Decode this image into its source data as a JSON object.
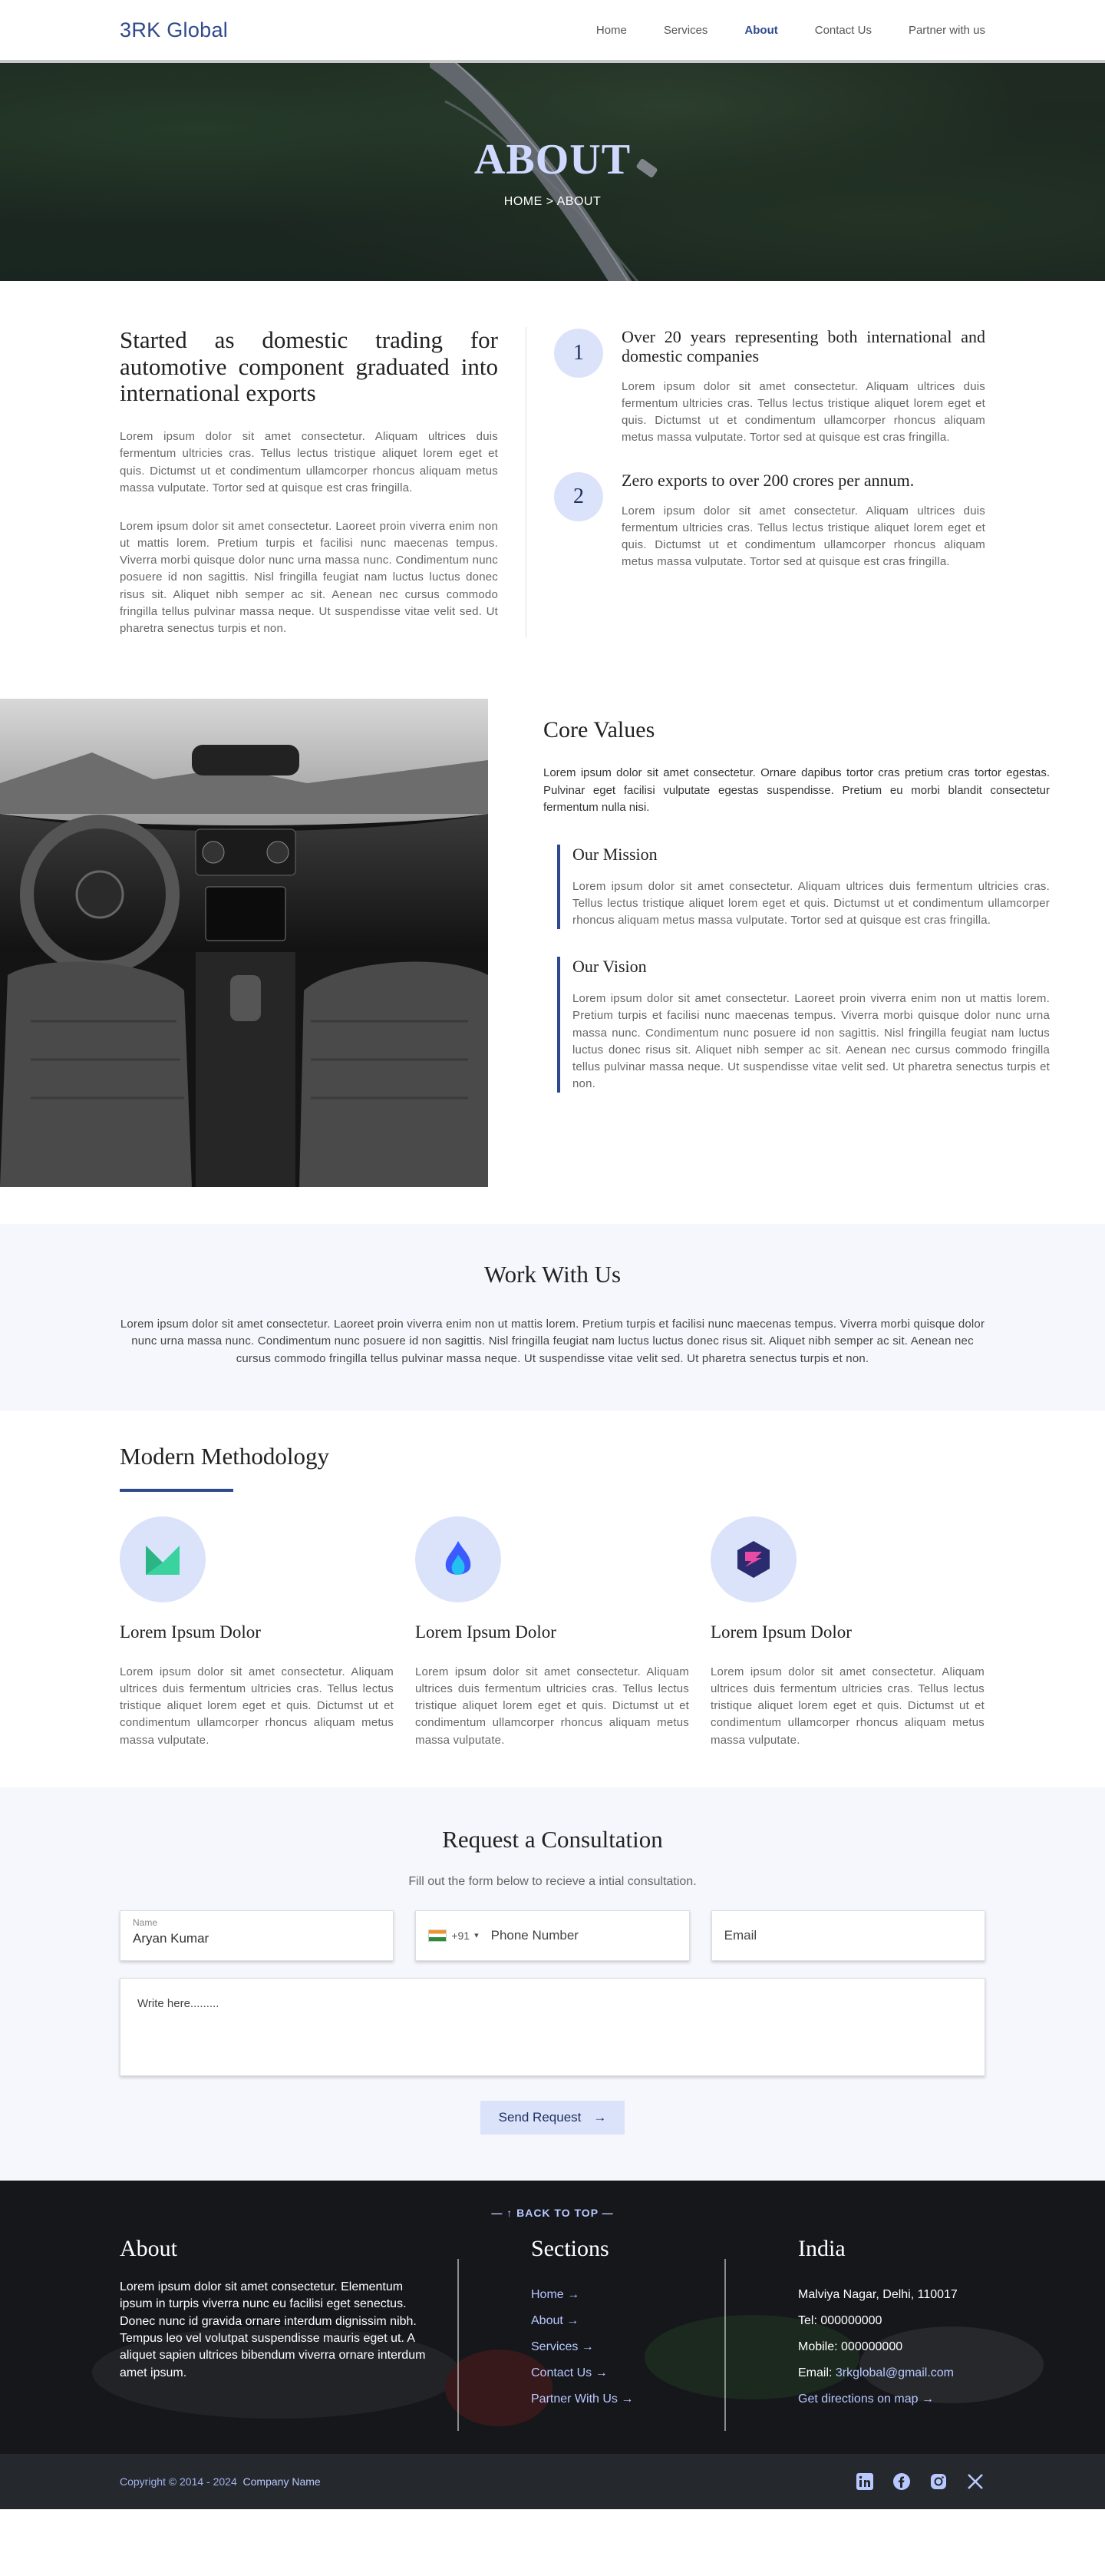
{
  "header": {
    "logo": "3RK Global",
    "nav": [
      "Home",
      "Services",
      "About",
      "Contact Us",
      "Partner with us"
    ],
    "active": "About"
  },
  "hero": {
    "title": "ABOUT",
    "breadcrumb": "HOME > ABOUT"
  },
  "intro": {
    "heading": "Started as domestic trading for automotive component graduated into international exports",
    "p1": "Lorem ipsum dolor sit amet consectetur. Aliquam ultrices duis fermentum ultricies cras. Tellus lectus tristique aliquet lorem eget et quis. Dictumst ut et condimentum ullamcorper rhoncus aliquam metus massa vulputate. Tortor sed at quisque est cras fringilla.",
    "p2": "Lorem ipsum dolor sit amet consectetur. Laoreet proin viverra enim non ut mattis lorem. Pretium turpis et facilisi nunc maecenas tempus. Viverra morbi quisque dolor nunc urna massa nunc. Condimentum nunc posuere id non sagittis. Nisl fringilla feugiat nam luctus luctus donec risus sit. Aliquet nibh semper ac sit. Aenean nec cursus commodo fringilla tellus pulvinar massa neque. Ut suspendisse vitae velit sed. Ut pharetra senectus turpis et non.",
    "features": [
      {
        "num": "1",
        "title": "Over 20 years representing both international and domestic companies",
        "text": "Lorem ipsum dolor sit amet consectetur. Aliquam ultrices duis fermentum ultricies cras. Tellus lectus tristique aliquet lorem eget et quis. Dictumst ut et condimentum ullamcorper rhoncus aliquam metus massa vulputate. Tortor sed at quisque est cras fringilla."
      },
      {
        "num": "2",
        "title": "Zero exports to over 200 crores per annum.",
        "text": "Lorem ipsum dolor sit amet consectetur. Aliquam ultrices duis fermentum ultricies cras. Tellus lectus tristique aliquet lorem eget et quis. Dictumst ut et condimentum ullamcorper rhoncus aliquam metus massa vulputate. Tortor sed at quisque est cras fringilla."
      }
    ]
  },
  "core": {
    "title": "Core Values",
    "lead": "Lorem ipsum dolor sit amet consectetur. Ornare dapibus tortor cras pretium cras tortor egestas. Pulvinar eget facilisi vulputate egestas suspendisse. Pretium eu morbi blandit consectetur fermentum nulla nisi.",
    "mission_title": "Our Mission",
    "mission_text": "Lorem ipsum dolor sit amet consectetur. Aliquam ultrices duis fermentum ultricies cras. Tellus lectus tristique aliquet lorem eget et quis. Dictumst ut et condimentum ullamcorper rhoncus aliquam metus massa vulputate. Tortor sed at quisque est cras fringilla.",
    "vision_title": "Our Vision",
    "vision_text": "Lorem ipsum dolor sit amet consectetur. Laoreet proin viverra enim non ut mattis lorem. Pretium turpis et facilisi nunc maecenas tempus. Viverra morbi quisque dolor nunc urna massa nunc. Condimentum nunc posuere id non sagittis. Nisl fringilla feugiat nam luctus luctus donec risus sit. Aliquet nibh semper ac sit. Aenean nec cursus commodo fringilla tellus pulvinar massa neque. Ut suspendisse vitae velit sed. Ut pharetra senectus turpis et non."
  },
  "work": {
    "title": "Work With Us",
    "text": "Lorem ipsum dolor sit amet consectetur. Laoreet proin viverra enim non ut mattis lorem. Pretium turpis et facilisi nunc maecenas tempus. Viverra morbi quisque dolor nunc urna massa nunc. Condimentum nunc posuere id non sagittis. Nisl fringilla feugiat nam luctus luctus donec risus sit. Aliquet nibh semper ac sit. Aenean nec cursus commodo fringilla tellus pulvinar massa neque. Ut suspendisse vitae velit sed. Ut pharetra senectus turpis et non."
  },
  "method": {
    "title": "Modern Methodology",
    "cards": [
      {
        "icon": "m-logo-icon",
        "title": "Lorem Ipsum Dolor",
        "text": "Lorem ipsum dolor sit amet consectetur. Aliquam ultrices duis fermentum ultricies cras. Tellus lectus tristique aliquet lorem eget et quis. Dictumst ut et condimentum ullamcorper rhoncus aliquam metus massa vulputate."
      },
      {
        "icon": "flame-icon",
        "title": "Lorem Ipsum Dolor",
        "text": "Lorem ipsum dolor sit amet consectetur. Aliquam ultrices duis fermentum ultricies cras. Tellus lectus tristique aliquet lorem eget et quis. Dictumst ut et condimentum ullamcorper rhoncus aliquam metus massa vulputate."
      },
      {
        "icon": "layers-icon",
        "title": "Lorem Ipsum Dolor",
        "text": "Lorem ipsum dolor sit amet consectetur. Aliquam ultrices duis fermentum ultricies cras. Tellus lectus tristique aliquet lorem eget et quis. Dictumst ut et condimentum ullamcorper rhoncus aliquam metus massa vulputate."
      }
    ]
  },
  "consult": {
    "title": "Request a Consultation",
    "sub": "Fill out the form below to recieve a intial consultation.",
    "name_label": "Name",
    "name_value": "Aryan Kumar",
    "phone_code": "+91",
    "phone_placeholder": "Phone Number",
    "email_placeholder": "Email",
    "message_placeholder": "Write here.........",
    "button": "Send Request"
  },
  "footer": {
    "back_to_top": "— ↑ BACK TO TOP —",
    "about_title": "About",
    "about_text": "Lorem ipsum dolor sit amet consectetur. Elementum ipsum in turpis viverra nunc eu facilisi eget senectus. Donec nunc id gravida ornare interdum dignissim nibh. Tempus leo vel volutpat suspendisse mauris eget ut. A aliquet sapien ultrices bibendum viverra ornare interdum amet ipsum.",
    "sections_title": "Sections",
    "sections": [
      "Home →",
      "About →",
      "Services →",
      "Contact Us →",
      "Partner With Us →"
    ],
    "india_title": "India",
    "address": "Malviya Nagar, Delhi, 110017",
    "tel": "Tel: 000000000",
    "mobile": "Mobile: 000000000",
    "email_label": "Email: ",
    "email": "3rkglobal@gmail.com",
    "directions": "Get directions on map →",
    "copyright": "Copyright © 2014 - 2024",
    "company": "Company Name",
    "social": [
      "linkedin-icon",
      "facebook-icon",
      "instagram-icon",
      "x-icon"
    ]
  },
  "colors": {
    "brand": "#2f4a8c",
    "accent_light": "#dbe3fb",
    "section_bg": "#f6f7fc",
    "footer_link": "#b9c8ff"
  }
}
